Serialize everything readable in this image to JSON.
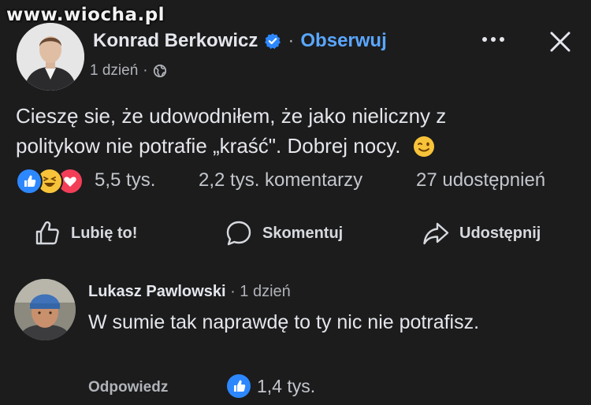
{
  "watermark": "www.wiocha.pl",
  "post": {
    "author": "Konrad Berkowicz",
    "separator": "·",
    "follow_label": "Obserwuj",
    "time": "1 dzień",
    "time_separator": "·",
    "text": "Cieszę sie, że udowodniłem, że jako nieliczny z politykow nie potrafie „kraść\". Dobrej nocy.",
    "emoji": "wink-emoji",
    "reactions_count": "5,5 tys.",
    "comments_count": "2,2 tys. komentarzy",
    "shares_count": "27 udostępnień",
    "actions": {
      "like": "Lubię to!",
      "comment": "Skomentuj",
      "share": "Udostępnij"
    }
  },
  "comment": {
    "author": "Lukasz Pawlowski",
    "separator": " · ",
    "time": "1 dzień",
    "text": "W sumie tak naprawdę  to ty nic nie potrafisz.",
    "reply_label": "Odpowiedz",
    "likes_count": "1,4 tys."
  },
  "colors": {
    "background": "#1c1c1d",
    "text": "#e4e6eb",
    "secondary_text": "#b0b3b8",
    "link_blue": "#5aa7ff",
    "like_blue": "#2d88ff",
    "love_red": "#f33e58",
    "haha_yellow": "#f7c33a"
  },
  "icons": [
    "verified-badge-icon",
    "globe-icon",
    "more-icon",
    "close-icon",
    "like-thumb-icon",
    "comment-bubble-icon",
    "share-arrow-icon"
  ]
}
